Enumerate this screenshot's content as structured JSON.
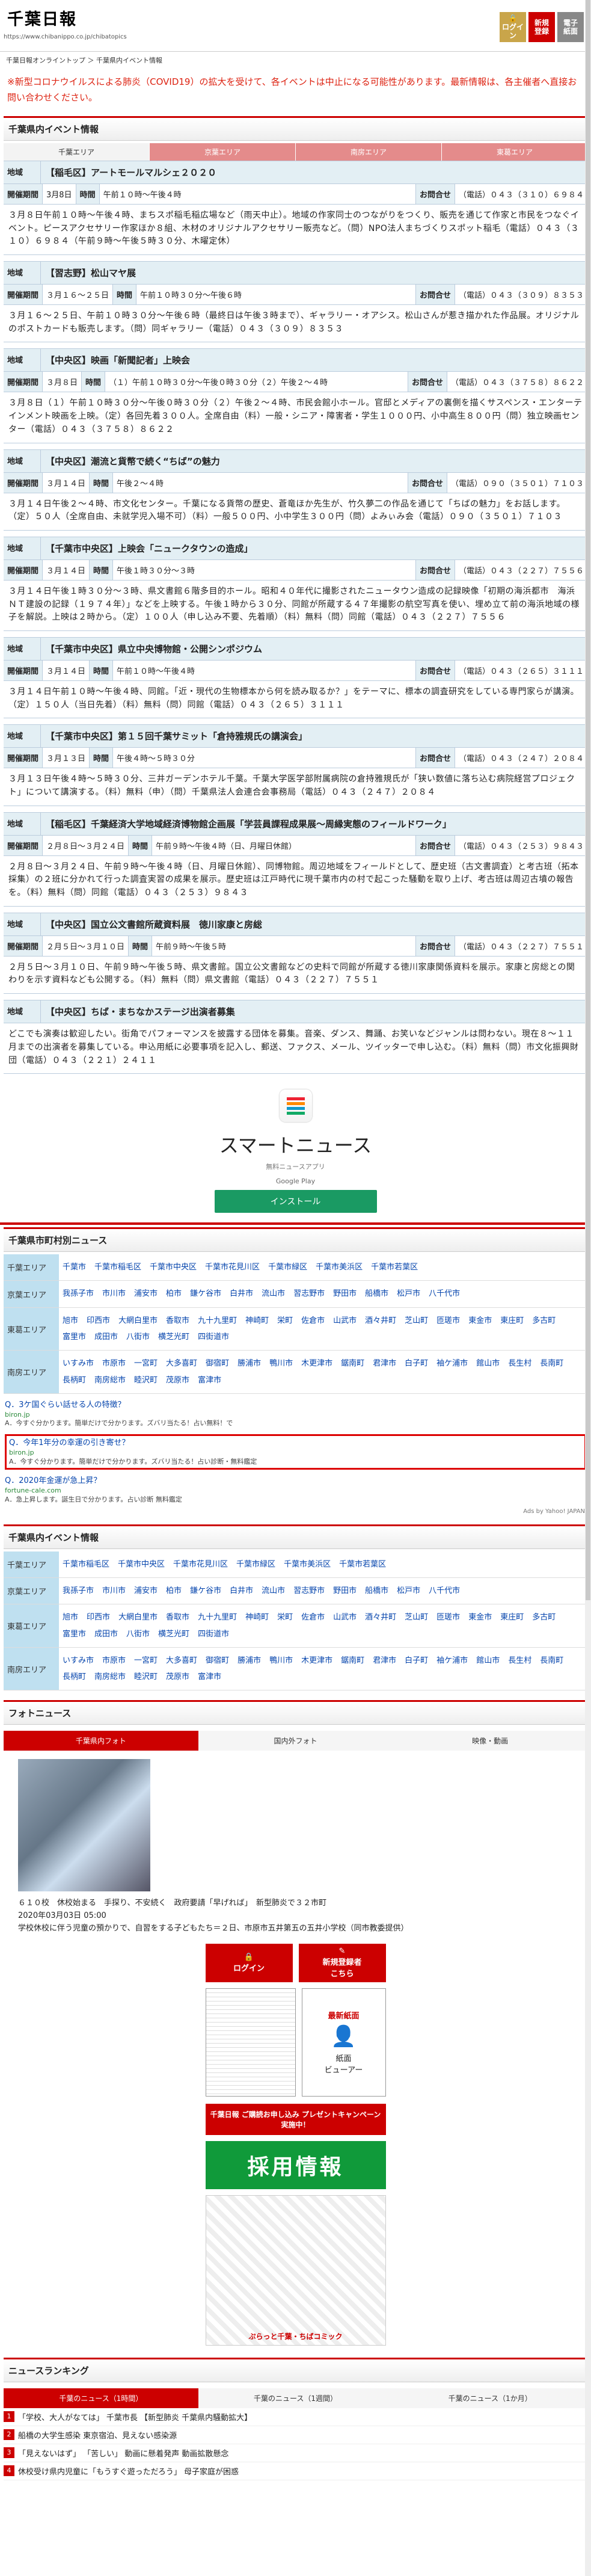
{
  "header": {
    "logo": "千葉日報",
    "url": "https://www.chibanippo.co.jp/chibatopics",
    "icon1": "ログイン",
    "icon2": "新規\n登録",
    "icon3": "電子\n紙面"
  },
  "breadcrumb": "千葉日報オンライントップ ＞ 千葉県内イベント情報",
  "notice": "※新型コロナウイルスによる肺炎（COVID19）の拡大を受けて、各イベントは中止になる可能性があります。最新情報は、各主催者へ直接お問い合わせください。",
  "events_title": "千葉県内イベント情報",
  "area_tabs": [
    "千葉エリア",
    "京葉エリア",
    "南房エリア",
    "東葛エリア"
  ],
  "events": [
    {
      "area": "地域",
      "title": "【稲毛区】アートモールマルシェ２０２０",
      "date": "3月8日",
      "time": "午前１０時〜午後４時",
      "contact": "（電話）０４３（３１０）６９８４",
      "body": "３月８日午前１０時〜午後４時、まちスポ稲毛稲広場など（雨天中止）。地域の作家同士のつながりをつくり、販売を通じて作家と市民をつなぐイベント。ピースアクセサリー作家ほか８組、木材のオリジナルアクセサリー販売など。（問）NPO法人まちづくりスポット稲毛（電話）０４３（３１０）６９８４（午前９時〜午後５時３０分、木曜定休）"
    },
    {
      "area": "地域",
      "title": "【習志野】松山マヤ展",
      "date": "３月１６〜２５日",
      "time": "午前１０時３０分〜午後６時",
      "contact": "（電話）０４３（３０９）８３５３",
      "body": "３月１６〜２５日、午前１０時３０分〜午後６時（最終日は午後３時まで）、ギャラリー・オアシス。松山さんが惹き描かれた作品展。オリジナルのポストカードも販売します。（問）同ギャラリー（電話）０４３（３０９）８３５３"
    },
    {
      "area": "地域",
      "title": "【中央区】映画「新聞記者」上映会",
      "date": "３月８日",
      "time": "（１）午前１０時３０分〜午後０時３０分（２）午後２〜４時",
      "contact": "（電話）０４３（３７５８）８６２２",
      "body": "３月８日（１）午前１０時３０分〜午後０時３０分（２）午後２〜４時、市民会館小ホール。官邸とメディアの裏側を描くサスペンス・エンターテインメント映画を上映。（定）各回先着３００人。全席自由（料）一般・シニア・障害者・学生１０００円、小中高生８００円（問）独立映画センター（電話）０４３（３７５８）８６２２"
    },
    {
      "area": "地域",
      "title": "【中央区】潮流と貨幣で続く“ちば”の魅力",
      "date": "３月１４日",
      "time": "午後２〜４時",
      "contact": "（電話）０９０（３５０１）７１０３",
      "body": "３月１４日午後２〜４時、市文化センター。千葉になる貨幣の歴史、蒼竜ほか先生が、竹久夢二の作品を通じて「ちばの魅力」をお話します。（定）５０人（全席自由、未就学児入場不可）（料）一般５００円、小中学生３００円（問）よみぃみ会（電話）０９０（３５０１）７１０３"
    },
    {
      "area": "地域",
      "title": "【千葉市中央区】上映会「ニュークタウンの造成」",
      "date": "３月１４日",
      "time": "午後１時３０分〜３時",
      "contact": "（電話）０４３（２２７）７５５６",
      "body": "３月１４日午後１時３０分〜３時、県文書館６階多目的ホール。昭和４０年代に撮影されたニュータウン造成の記録映像「初期の海浜都市　海浜ＮＴ建設の記録（１９７４年）」などを上映する。午後１時から３０分、同館が所蔵する４７年撮影の航空写真を使い、埋め立て前の海浜地域の様子を解説。上映は２時から。（定）１００人（申し込み不要、先着順）（料）無料（問）同館（電話）０４３（２２７）７５５６"
    },
    {
      "area": "地域",
      "title": "【千葉市中央区】県立中央博物館・公開シンポジウム",
      "date": "３月１４日",
      "time": "午前１０時〜午後４時",
      "contact": "（電話）０４３（２６５）３１１１",
      "body": "３月１４日午前１０時〜午後４時、同館。「近・現代の生物標本から何を読み取るか？」をテーマに、標本の調査研究をしている専門家らが講演。（定）１５０人（当日先着）（料）無料（問）同館（電話）０４３（２６５）３１１１"
    },
    {
      "area": "地域",
      "title": "【千葉市中央区】第１５回千葉サミット「倉持雅規氏の講演会」",
      "date": "３月１３日",
      "time": "午後４時〜５時３０分",
      "contact": "（電話）０４３（２４７）２０８４",
      "body": "３月１３日午後４時〜５時３０分、三井ガーデンホテル千葉。千葉大学医学部附属病院の倉持雅規氏が「狭い数値に落ち込む病院経営プロジェクト」について講演する。（料）無料（申）（問）千葉県法人会連合会事務局（電話）０４３（２４７）２０８４"
    },
    {
      "area": "地域",
      "title": "【稲毛区】千葉経済大学地域経済博物館企画展「学芸員課程成果展〜周縁実態のフィールドワーク」",
      "date": "２月８日〜３月２４日",
      "time": "午前９時〜午後４時（日、月曜日休館）",
      "contact": "（電話）０４３（２５３）９８４３",
      "body": "２月８日〜３月２４日、午前９時〜午後４時（日、月曜日休館）、同博物館。周辺地域をフィールドとして、歴史班（古文書調査）と考古班（拓本採集）の２班に分かれて行った調査実習の成果を展示。歴史班は江戸時代に現千葉市内の村で起こった騒動を取り上げ、考古班は周辺古墳の報告を。（料）無料（問）同館（電話）０４３（２５３）９８４３"
    },
    {
      "area": "地域",
      "title": "【中央区】国立公文書館所蔵資料展　徳川家康と房総",
      "date": "２月５日〜３月１０日",
      "time": "午前９時〜午後５時",
      "contact": "（電話）０４３（２２７）７５５１",
      "body": "２月５日〜３月１０日、午前９時〜午後５時、県文書館。国立公文書館などの史料で同館が所蔵する徳川家康関係資料を展示。家康と房総との関わりを示す資料なども公開する。（料）無料（問）県文書館（電話）０４３（２２７）７５５１"
    },
    {
      "area": "地域",
      "title": "【中央区】ちば・まちなかステージ出演者募集",
      "date": "",
      "time": "",
      "contact": "（電話）０４３（２２１）２４１１",
      "body": "どこでも演奏は歓迎したい。街角でパフォーマンスを披露する団体を募集。音楽、ダンス、舞踊、お笑いなどジャンルは問わない。現在８〜１１月までの出演者を募集している。申込用紙に必要事項を記入し、郵送、ファクス、メール、ツイッターで申し込む。（料）無料（問）市文化振興財団（電話）０４３（２２１）２４１１"
    }
  ],
  "ad": {
    "title": "スマートニュース",
    "sub": "無料ニュースアプリ",
    "store": "Google Play",
    "button": "インストール"
  },
  "city_news_title": "千葉県市町村別ニュース",
  "city_areas": [
    {
      "label": "千葉エリア",
      "cities": [
        "千葉市",
        "千葉市稲毛区",
        "千葉市中央区",
        "千葉市花見川区",
        "千葉市緑区",
        "千葉市美浜区",
        "千葉市若葉区"
      ]
    },
    {
      "label": "京葉エリア",
      "cities": [
        "我孫子市",
        "市川市",
        "浦安市",
        "柏市",
        "鎌ケ谷市",
        "白井市",
        "流山市",
        "習志野市",
        "野田市",
        "船橋市",
        "松戸市",
        "八千代市"
      ]
    },
    {
      "label": "東葛エリア",
      "cities": [
        "旭市",
        "印西市",
        "大網白里市",
        "香取市",
        "九十九里町",
        "神崎町",
        "栄町",
        "佐倉市",
        "山武市",
        "酒々井町",
        "芝山町",
        "匝瑳市",
        "東金市",
        "東庄町",
        "多古町",
        "富里市",
        "成田市",
        "八街市",
        "横芝光町",
        "四街道市"
      ]
    },
    {
      "label": "南房エリア",
      "cities": [
        "いすみ市",
        "市原市",
        "一宮町",
        "大多喜町",
        "御宿町",
        "勝浦市",
        "鴨川市",
        "木更津市",
        "鋸南町",
        "君津市",
        "白子町",
        "袖ケ浦市",
        "館山市",
        "長生村",
        "長南町",
        "長柄町",
        "南房総市",
        "睦沢町",
        "茂原市",
        "富津市"
      ]
    }
  ],
  "quizzes": [
    {
      "title": "Q．3ケ国ぐらい話せる人の特徴？",
      "domain": "biron.jp",
      "desc": "A．今すぐ分かります。簡単だけで分かります。ズバリ当たる！占い無料！で"
    },
    {
      "title": "Q．今年1年分の幸運の引き寄せ？",
      "domain": "biron.jp",
      "desc": "A．今すぐ分かります。簡単だけで分かります。ズバリ当たる！占い診断・無料鑑定"
    },
    {
      "title": "Q．2020年金運が急上昇？",
      "domain": "fortune-cale.com",
      "desc": "A．急上昇します。誕生日で分かります。占い診断 無料鑑定"
    }
  ],
  "ads_by": "Ads by Yahoo! JAPAN",
  "events_title2": "千葉県内イベント情報",
  "event_areas": [
    {
      "label": "千葉エリア",
      "cities": [
        "千葉市稲毛区",
        "千葉市中央区",
        "千葉市花見川区",
        "千葉市緑区",
        "千葉市美浜区",
        "千葉市若葉区"
      ]
    },
    {
      "label": "京葉エリア",
      "cities": [
        "我孫子市",
        "市川市",
        "浦安市",
        "柏市",
        "鎌ケ谷市",
        "白井市",
        "流山市",
        "習志野市",
        "野田市",
        "船橋市",
        "松戸市",
        "八千代市"
      ]
    },
    {
      "label": "東葛エリア",
      "cities": [
        "旭市",
        "印西市",
        "大網白里市",
        "香取市",
        "九十九里町",
        "神崎町",
        "栄町",
        "佐倉市",
        "山武市",
        "酒々井町",
        "芝山町",
        "匝瑳市",
        "東金市",
        "東庄町",
        "多古町",
        "富里市",
        "成田市",
        "八街市",
        "横芝光町",
        "四街道市"
      ]
    },
    {
      "label": "南房エリア",
      "cities": [
        "いすみ市",
        "市原市",
        "一宮町",
        "大多喜町",
        "御宿町",
        "勝浦市",
        "鴨川市",
        "木更津市",
        "鋸南町",
        "君津市",
        "白子町",
        "袖ケ浦市",
        "館山市",
        "長生村",
        "長南町",
        "長柄町",
        "南房総市",
        "睦沢町",
        "茂原市",
        "富津市"
      ]
    }
  ],
  "photo_news_title": "フォトニュース",
  "photo_tabs": [
    "千葉県内フォト",
    "国内外フォト",
    "映像・動画"
  ],
  "photo_caption": "６１０校　休校始まる　手探り、不安続く　政府要請「早げれば」　新型肺炎で３２市町",
  "photo_date": "2020年03月03日 05:00",
  "photo_sub": "学校休校に伴う児童の預かりで、自習をする子どもたち＝２日、市原市五井第五の五井小学校（同市教委提供）",
  "side": {
    "login": "ログイン",
    "register": "新規登録者\nこちら",
    "newest": "最新紙面",
    "viewer": "紙面\nビューアー",
    "campaign": "千葉日報 ご購読お申し込み プレゼントキャンペーン実施中！",
    "jobs": "採用情報",
    "comic": "ぷらっと千葉・ちばコミック"
  },
  "ranking_title": "ニュースランキング",
  "ranking_tabs": [
    "千葉のニュース（1時間）",
    "千葉のニュース（1週間）",
    "千葉のニュース（1か月）"
  ],
  "ranking": [
    "「学校、大人がなては」 千葉市長 【新型肺炎 千葉県内騒動拡大】",
    "船橋の大学生感染 東京宿泊、見えない感染源",
    "「見えないはず」 「苦しい」 動画に懸着発声 動画拡散懸念",
    "休校受け県内児童に「もうすぐ遊っただろう」 母子家庭が困惑"
  ]
}
